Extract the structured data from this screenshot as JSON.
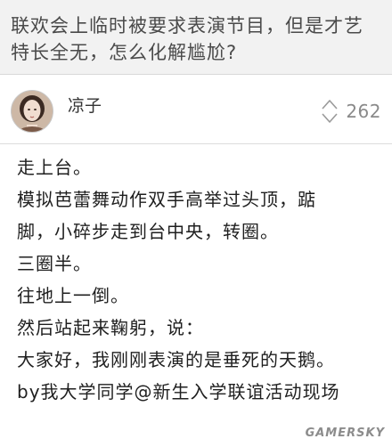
{
  "question": {
    "title_line1": "联欢会上临时被要求表演节目，但是才艺",
    "title_line2": "特长全无，怎么化解尴尬?"
  },
  "author": {
    "name": "凉子",
    "avatar_icon": "portrait-avatar-icon"
  },
  "votes": {
    "icon": "up-down-vote-icon",
    "count": "262"
  },
  "answer": {
    "lines": [
      "走上台。",
      "模拟芭蕾舞动作双手高举过头顶，踮",
      "脚，小碎步走到台中央，转圈。",
      "三圈半。",
      "往地上一倒。",
      "然后站起来鞠躬，说：",
      "大家好，我刚刚表演的是垂死的天鹅。",
      "by我大学同学@新生入学联谊活动现场"
    ]
  },
  "watermark": "GAMERSKY",
  "colors": {
    "header_bg": "#f2f2f2",
    "title_text": "#4a4a4a",
    "vote_gray": "#8a8a8a"
  }
}
